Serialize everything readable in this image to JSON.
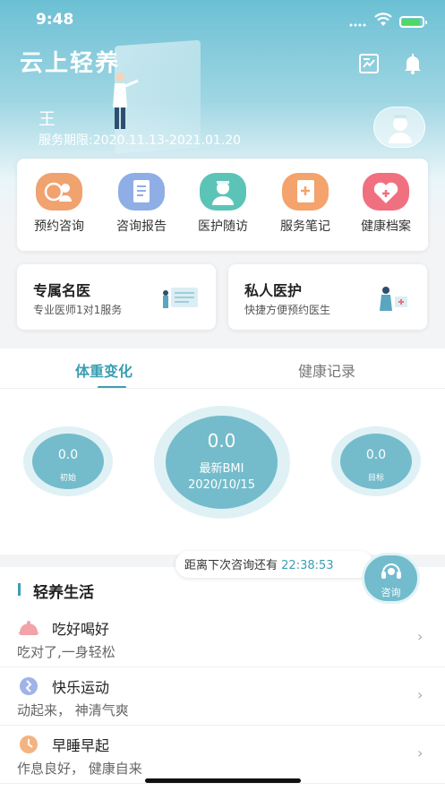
{
  "status_bar": {
    "time": "9:48"
  },
  "header": {
    "app_title": "云上轻养",
    "report_icon": "report-icon",
    "bell_icon": "bell-icon"
  },
  "user": {
    "name": "王",
    "service_period": "服务期限:2020.11.13-2021.01.20",
    "avatar_icon": "doctor-avatar-icon"
  },
  "menu": [
    {
      "label": "预约咨询",
      "icon": "appointment-icon",
      "color": "#f0a26f"
    },
    {
      "label": "咨询报告",
      "icon": "report-doc-icon",
      "color": "#8faee6"
    },
    {
      "label": "医护随访",
      "icon": "nurse-icon",
      "color": "#5cc4b7"
    },
    {
      "label": "服务笔记",
      "icon": "notebook-icon",
      "color": "#f3a36b"
    },
    {
      "label": "健康档案",
      "icon": "health-heart-icon",
      "color": "#f0707f"
    }
  ],
  "services": [
    {
      "title": "专属名医",
      "subtitle": "专业医师1对1服务"
    },
    {
      "title": "私人医护",
      "subtitle": "快捷方便预约医生"
    }
  ],
  "weight": {
    "tabs": [
      "体重变化",
      "健康记录"
    ],
    "initial": {
      "value": "0.0",
      "label": "初始"
    },
    "latest": {
      "value": "0.0",
      "label": "最新BMI",
      "date": "2020/10/15"
    },
    "target": {
      "value": "0.0",
      "label": "目标"
    }
  },
  "consult": {
    "countdown_label": "距离下次咨询还有",
    "countdown_time": "22:38:53",
    "button_label": "咨询"
  },
  "life": {
    "title": "轻养生活",
    "items": [
      {
        "title": "吃好喝好",
        "subtitle": "吃对了,一身轻松",
        "icon": "food-cloche-icon",
        "color": "#f2a3a8"
      },
      {
        "title": "快乐运动",
        "subtitle": "动起来， 神清气爽",
        "icon": "exercise-icon",
        "color": "#9fb3e8"
      },
      {
        "title": "早睡早起",
        "subtitle": "作息良好， 健康自来",
        "icon": "clock-icon",
        "color": "#f4b383"
      }
    ]
  },
  "colors": {
    "accent": "#3a9fb3",
    "bubble": "#74bccb"
  }
}
